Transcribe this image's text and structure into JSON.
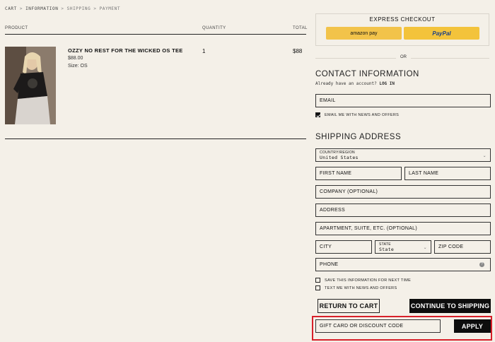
{
  "breadcrumb": [
    "CART",
    "INFORMATION",
    "SHIPPING",
    "PAYMENT"
  ],
  "breadcrumb_sep": ">",
  "table": {
    "col_product": "PRODUCT",
    "col_quantity": "QUANTITY",
    "col_total": "TOTAL"
  },
  "product": {
    "name": "OZZY NO REST FOR THE WICKED OS TEE",
    "price": "$88.00",
    "size": "Size: OS",
    "quantity": "1",
    "total": "$88"
  },
  "express": {
    "title": "EXPRESS CHECKOUT",
    "amazon_label": "amazon pay",
    "paypal_label": "PayPal",
    "or": "OR"
  },
  "contact": {
    "heading": "CONTACT INFORMATION",
    "account_prompt": "Already have an account?",
    "login_link": "LOG IN",
    "email_placeholder": "EMAIL",
    "news_label": "EMAIL ME WITH NEWS AND OFFERS",
    "news_checked": true
  },
  "shipping": {
    "heading": "SHIPPING ADDRESS",
    "country_label": "COUNTRY/REGION",
    "country_value": "United States",
    "first_name": "FIRST NAME",
    "last_name": "LAST NAME",
    "company": "COMPANY (OPTIONAL)",
    "address": "ADDRESS",
    "apartment": "APARTMENT, SUITE, ETC. (OPTIONAL)",
    "city": "CITY",
    "state_label": "STATE",
    "state_value": "State",
    "zip": "ZIP CODE",
    "phone": "PHONE",
    "save_info_label": "SAVE THIS INFORMATION FOR NEXT TIME",
    "text_me_label": "TEXT ME WITH NEWS AND OFFERS"
  },
  "actions": {
    "return": "RETURN TO CART",
    "continue": "CONTINUE TO SHIPPING"
  },
  "discount": {
    "placeholder": "GIFT CARD OR DISCOUNT CODE",
    "apply": "APPLY"
  },
  "colors": {
    "background": "#f4f0e8",
    "amazon": "#f2c34a",
    "paypal": "#f3c33b",
    "highlight": "#d8202a",
    "dark_button": "#0d0d0d"
  }
}
